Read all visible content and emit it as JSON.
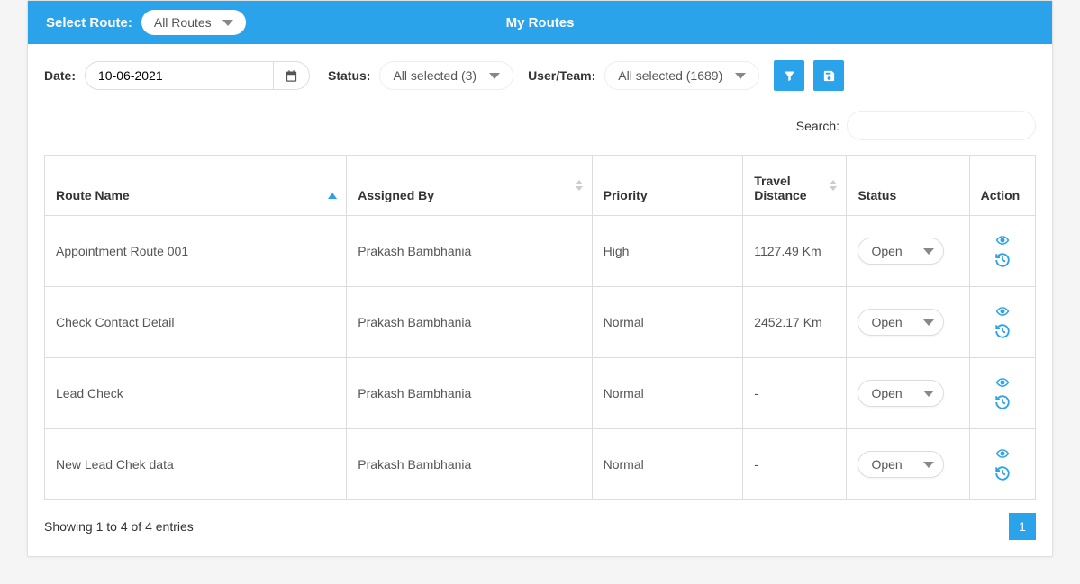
{
  "header": {
    "select_route_label": "Select Route:",
    "route_dropdown_value": "All Routes",
    "title": "My Routes"
  },
  "filters": {
    "date_label": "Date:",
    "date_value": "10-06-2021",
    "status_label": "Status:",
    "status_value": "All selected (3)",
    "userteam_label": "User/Team:",
    "userteam_value": "All selected (1689)"
  },
  "search": {
    "label": "Search:",
    "value": ""
  },
  "table": {
    "columns": {
      "route_name": "Route Name",
      "assigned_by": "Assigned By",
      "priority": "Priority",
      "travel_distance": "Travel Distance",
      "status": "Status",
      "action": "Action"
    },
    "rows": [
      {
        "route_name": "Appointment Route 001",
        "assigned_by": "Prakash Bambhania",
        "priority": "High",
        "travel_distance": "1127.49 Km",
        "status": "Open"
      },
      {
        "route_name": "Check Contact Detail",
        "assigned_by": "Prakash Bambhania",
        "priority": "Normal",
        "travel_distance": "2452.17 Km",
        "status": "Open"
      },
      {
        "route_name": "Lead Check",
        "assigned_by": "Prakash Bambhania",
        "priority": "Normal",
        "travel_distance": "-",
        "status": "Open"
      },
      {
        "route_name": "New Lead Chek data",
        "assigned_by": "Prakash Bambhania",
        "priority": "Normal",
        "travel_distance": "-",
        "status": "Open"
      }
    ]
  },
  "footer": {
    "entries_text": "Showing 1 to 4 of 4 entries",
    "pages": [
      "1"
    ]
  }
}
